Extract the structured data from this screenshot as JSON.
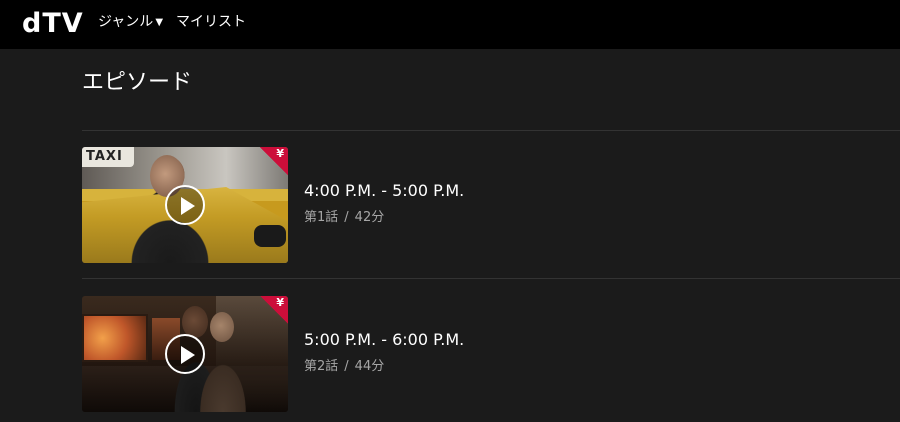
{
  "header": {
    "logo": "dTV",
    "nav": {
      "genre_label": "ジャンル",
      "genre_caret": "▼",
      "mylist_label": "マイリスト"
    }
  },
  "section": {
    "title": "エピソード"
  },
  "episodes": [
    {
      "title": "4:00 P.M. - 5:00 P.M.",
      "episode_label": "第1話",
      "separator": "/",
      "duration": "42分",
      "badge": "¥",
      "thumb_sign": "TAXI"
    },
    {
      "title": "5:00 P.M. - 6:00 P.M.",
      "episode_label": "第2話",
      "separator": "/",
      "duration": "44分",
      "badge": "¥"
    }
  ],
  "colors": {
    "background": "#1b1b1b",
    "header": "#000000",
    "badge": "#cc0e3a",
    "meta_text": "#a6a6a6"
  }
}
